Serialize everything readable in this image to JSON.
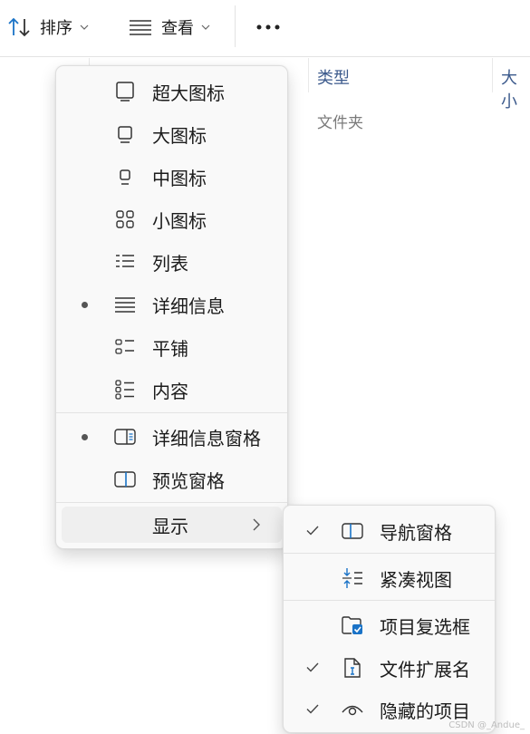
{
  "toolbar": {
    "sort_label": "排序",
    "view_label": "查看"
  },
  "list": {
    "col_type": "类型",
    "col_size": "大小",
    "row1_type": "文件夹"
  },
  "view_menu": {
    "items": [
      {
        "label": "超大图标"
      },
      {
        "label": "大图标"
      },
      {
        "label": "中图标"
      },
      {
        "label": "小图标"
      },
      {
        "label": "列表"
      },
      {
        "label": "详细信息",
        "selected": true
      },
      {
        "label": "平铺"
      },
      {
        "label": "内容"
      },
      {
        "label": "详细信息窗格",
        "selected": true
      },
      {
        "label": "预览窗格"
      },
      {
        "label": "显示"
      }
    ]
  },
  "show_submenu": {
    "items": [
      {
        "label": "导航窗格",
        "checked": true
      },
      {
        "label": "紧凑视图",
        "checked": false
      },
      {
        "label": "项目复选框",
        "checked": false
      },
      {
        "label": "文件扩展名",
        "checked": true
      },
      {
        "label": "隐藏的项目",
        "checked": true
      }
    ]
  },
  "watermark": "CSDN @_Andue_",
  "colors": {
    "accent": "#1a73c7",
    "menu_bg": "#f9f9f9",
    "hover": "#efefef"
  }
}
